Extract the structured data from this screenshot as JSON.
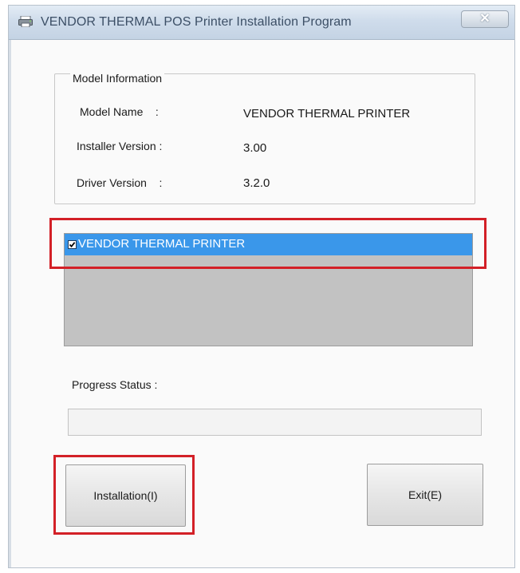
{
  "window": {
    "title": "VENDOR THERMAL POS Printer Installation Program",
    "close_label": "✕",
    "icon": "printer-icon"
  },
  "model_info": {
    "legend": "Model Information",
    "rows": [
      {
        "label": "Model Name    :",
        "value": "VENDOR THERMAL PRINTER"
      },
      {
        "label": "Installer Version :",
        "value": "3.00"
      },
      {
        "label": "Driver Version    :",
        "value": "3.2.0"
      }
    ]
  },
  "printer_list": {
    "items": [
      {
        "label": "VENDOR THERMAL PRINTER",
        "checked": true,
        "selected": true
      }
    ],
    "selected_color": "#3a97ea"
  },
  "progress": {
    "label": "Progress Status :",
    "value": 0
  },
  "buttons": {
    "install_label": "Installation(I)",
    "exit_label": "Exit(E)"
  },
  "highlights": {
    "color": "#d32027"
  }
}
